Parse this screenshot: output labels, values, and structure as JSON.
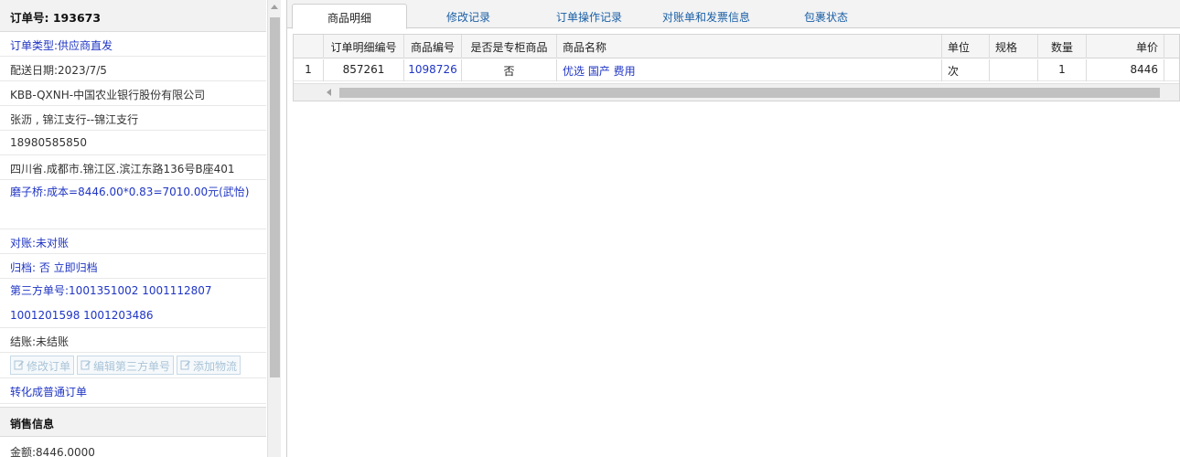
{
  "order": {
    "label": "订单号:",
    "number": "193673"
  },
  "info_rows": [
    "订单类型:供应商直发",
    "配送日期:2023/7/5",
    "KBB-QXNH-中国农业银行股份有限公司",
    "张沥 , 锦江支行--锦江支行",
    "18980585850",
    "四川省.成都市.锦江区.滨江东路136号B座401",
    "磨子桥:成本=8446.00*0.83=7010.00元(武怡)",
    "对账:未对账",
    "归档: 否 立即归档",
    "第三方单号:1001351002 1001112807 1001201598 1001203486",
    "结账:未结账"
  ],
  "buttons": {
    "edit_order": "修改订单",
    "edit_third": "编辑第三方单号",
    "add_logistics": "添加物流"
  },
  "convert_link": "转化成普通订单",
  "sales_section": {
    "title": "销售信息",
    "amount": "金额:8446.0000"
  },
  "tabs": [
    "商品明细",
    "修改记录",
    "订单操作记录",
    "对账单和发票信息",
    "包裹状态"
  ],
  "grid": {
    "columns": [
      "订单明细编号",
      "商品编号",
      "是否是专柜商品",
      "商品名称",
      "单位",
      "规格",
      "数量",
      "单价"
    ],
    "rows": [
      {
        "index": "1",
        "detail_no": "857261",
        "product_no": "1098726",
        "is_counter": "否",
        "name": "优选 国产 费用",
        "unit": "次",
        "spec": "",
        "qty": "1",
        "price": "8446"
      }
    ]
  },
  "colors": {
    "link_blue": "#1f35c4",
    "tab_blue": "#1a5fa6",
    "disabled_btn": "#a9c4d8"
  }
}
